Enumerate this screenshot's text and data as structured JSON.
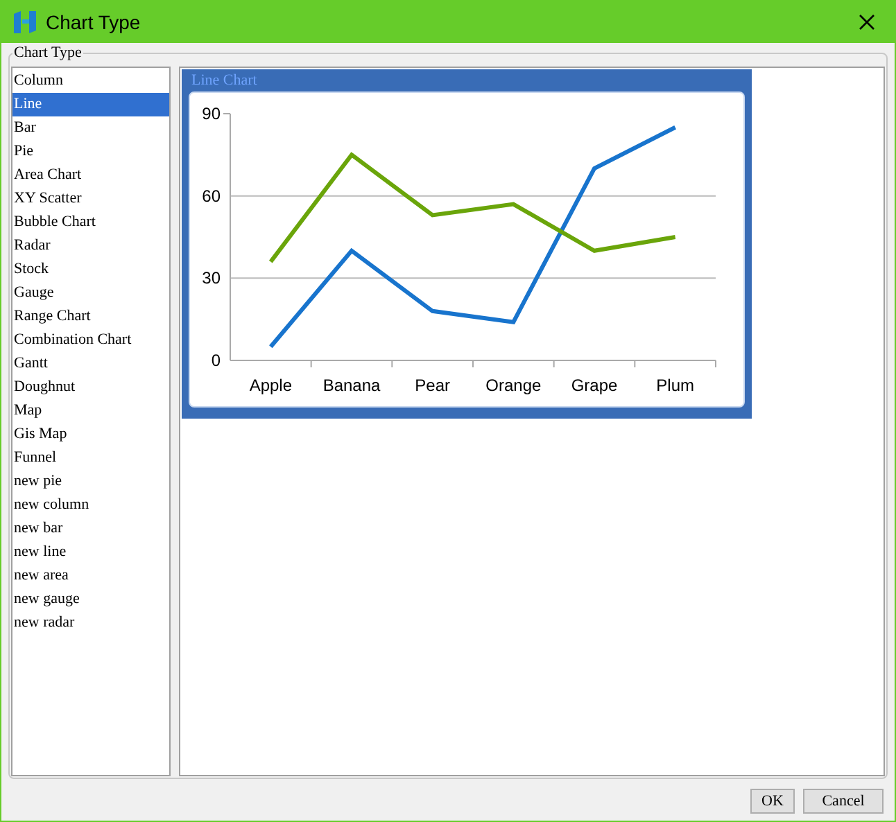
{
  "window": {
    "title": "Chart Type"
  },
  "group": {
    "label": "Chart Type"
  },
  "chart_types": [
    {
      "label": "Column",
      "selected": false
    },
    {
      "label": "Line",
      "selected": true
    },
    {
      "label": "Bar",
      "selected": false
    },
    {
      "label": "Pie",
      "selected": false
    },
    {
      "label": "Area Chart",
      "selected": false
    },
    {
      "label": "XY Scatter",
      "selected": false
    },
    {
      "label": "Bubble Chart",
      "selected": false
    },
    {
      "label": "Radar",
      "selected": false
    },
    {
      "label": "Stock",
      "selected": false
    },
    {
      "label": "Gauge",
      "selected": false
    },
    {
      "label": "Range Chart",
      "selected": false
    },
    {
      "label": "Combination Chart",
      "selected": false
    },
    {
      "label": "Gantt",
      "selected": false
    },
    {
      "label": "Doughnut",
      "selected": false
    },
    {
      "label": "Map",
      "selected": false
    },
    {
      "label": "Gis Map",
      "selected": false
    },
    {
      "label": "Funnel",
      "selected": false
    },
    {
      "label": "new pie",
      "selected": false
    },
    {
      "label": "new column",
      "selected": false
    },
    {
      "label": "new bar",
      "selected": false
    },
    {
      "label": "new line",
      "selected": false
    },
    {
      "label": "new area",
      "selected": false
    },
    {
      "label": "new gauge",
      "selected": false
    },
    {
      "label": "new radar",
      "selected": false
    }
  ],
  "preview": {
    "label": "Line Chart",
    "chart_data": {
      "type": "line",
      "categories": [
        "Apple",
        "Banana",
        "Pear",
        "Orange",
        "Grape",
        "Plum"
      ],
      "ylim": [
        0,
        90
      ],
      "yticks": [
        0,
        30,
        60,
        90
      ],
      "series": [
        {
          "color": "#1874cd",
          "values": [
            5,
            40,
            18,
            14,
            70,
            85
          ]
        },
        {
          "color": "#6aa50a",
          "values": [
            36,
            75,
            53,
            57,
            40,
            45
          ]
        }
      ]
    }
  },
  "buttons": [
    "OK",
    "Cancel"
  ]
}
